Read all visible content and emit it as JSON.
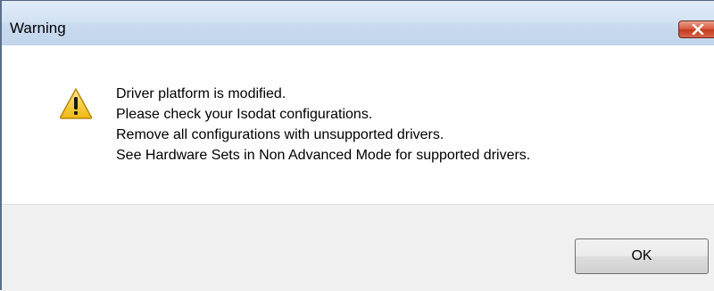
{
  "window": {
    "title": "Warning"
  },
  "message": {
    "lines": [
      "Driver platform is modified.",
      "Please check your Isodat configurations.",
      "Remove all configurations with unsupported drivers.",
      "See Hardware Sets in Non Advanced Mode for supported drivers."
    ],
    "icon": "warning-icon"
  },
  "buttons": {
    "ok_label": "OK",
    "close_icon": "close-icon"
  },
  "colors": {
    "titlebar": "#d3e2f3",
    "close_button": "#d9593e",
    "footer": "#f0f0f0",
    "warning_icon": "#f5c518"
  }
}
